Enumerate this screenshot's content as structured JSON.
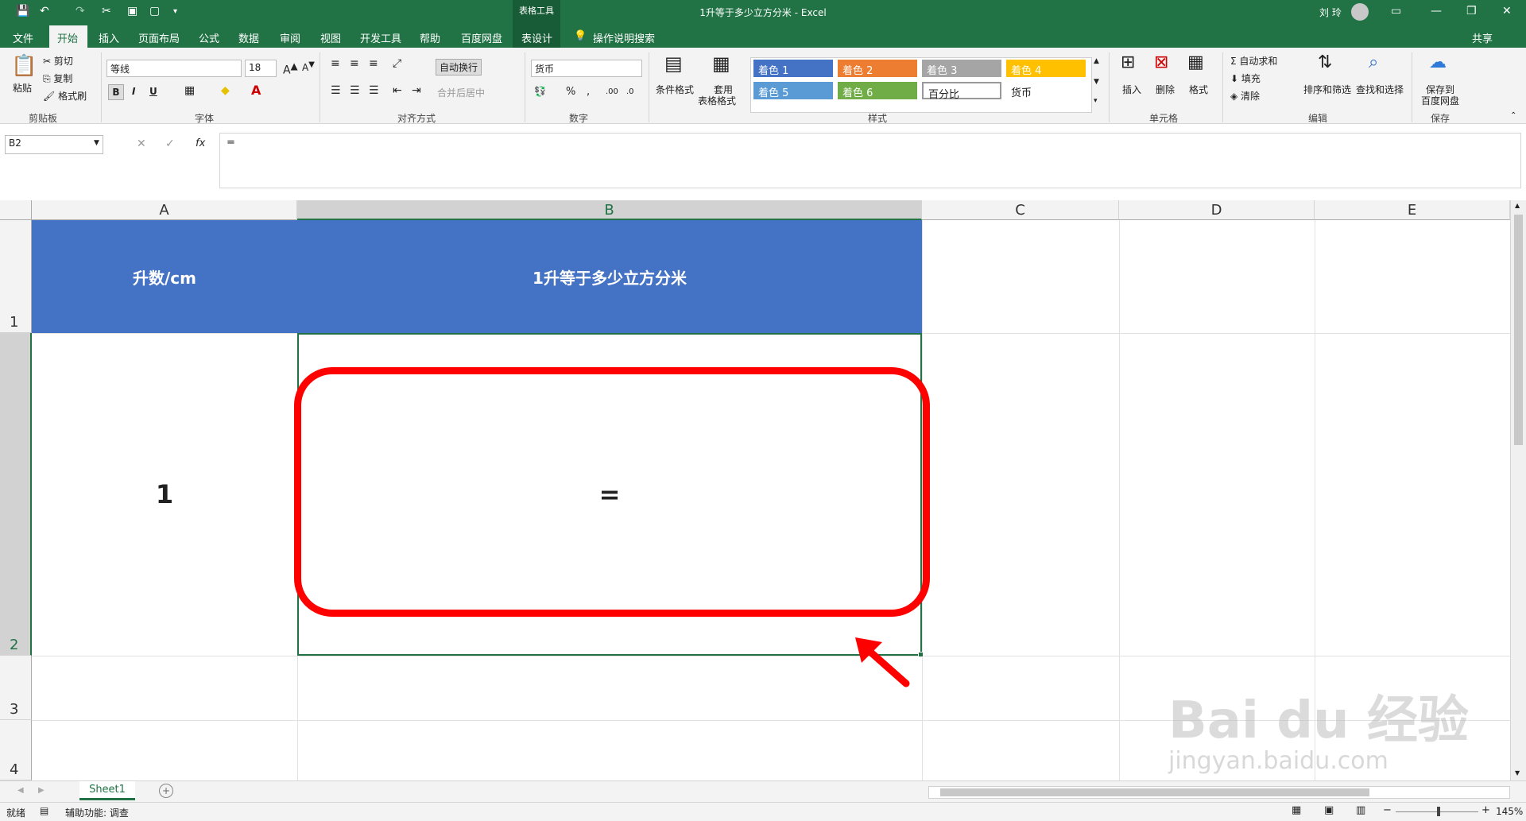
{
  "titlebar": {
    "table_tools": "表格工具",
    "title": "1升等于多少立方分米  -  Excel",
    "user": "刘 玲"
  },
  "tabs": [
    "文件",
    "开始",
    "插入",
    "页面布局",
    "公式",
    "数据",
    "审阅",
    "视图",
    "开发工具",
    "帮助",
    "百度网盘",
    "表设计"
  ],
  "tell_me": "操作说明搜索",
  "share": "共享",
  "ribbon": {
    "clipboard": {
      "paste": "粘贴",
      "cut": "剪切",
      "copy": "复制",
      "format_painter": "格式刷",
      "label": "剪贴板"
    },
    "font": {
      "name": "等线",
      "size": "18",
      "bold": "B",
      "italic": "I",
      "underline": "U",
      "label": "字体"
    },
    "alignment": {
      "wrap": "自动换行",
      "merge": "合并后居中",
      "label": "对齐方式"
    },
    "number": {
      "format": "货币",
      "label": "数字"
    },
    "styles": {
      "conditional": "条件格式",
      "table_format_1": "套用",
      "table_format_2": "表格格式",
      "cells": [
        "着色 1",
        "着色 2",
        "着色 3",
        "着色 4",
        "着色 5",
        "着色 6",
        "百分比",
        "货币"
      ],
      "label": "样式"
    },
    "cells": {
      "insert": "插入",
      "delete": "删除",
      "format": "格式",
      "label": "单元格"
    },
    "editing": {
      "autosum": "自动求和",
      "fill": "填充",
      "clear": "清除",
      "sort": "排序和筛选",
      "find": "查找和选择",
      "label": "编辑"
    },
    "save": {
      "line1": "保存到",
      "line2": "百度网盘",
      "label": "保存"
    },
    "colors": {
      "accent1": "#4472c4",
      "accent2": "#ed7d31",
      "accent3": "#a5a5a5",
      "accent4": "#ffc000",
      "accent5": "#5b9bd5",
      "accent6": "#70ad47"
    }
  },
  "formula_bar": {
    "name_box": "B2",
    "fx": "fx",
    "content": "="
  },
  "grid": {
    "columns": [
      "A",
      "B",
      "C",
      "D",
      "E"
    ],
    "rows": [
      "1",
      "2",
      "3",
      "4"
    ],
    "cells": {
      "A1": "升数/cm",
      "B1": "1升等于多少立方分米",
      "A2": "1",
      "B2": "="
    },
    "header_fill": "#4472c4"
  },
  "sheet_tab": "Sheet1",
  "status": {
    "ready": "就绪",
    "accessibility": "辅助功能: 调查",
    "zoom": "145%"
  },
  "watermark": {
    "brand": "Bai du 经验",
    "url": "jingyan.baidu.com"
  }
}
